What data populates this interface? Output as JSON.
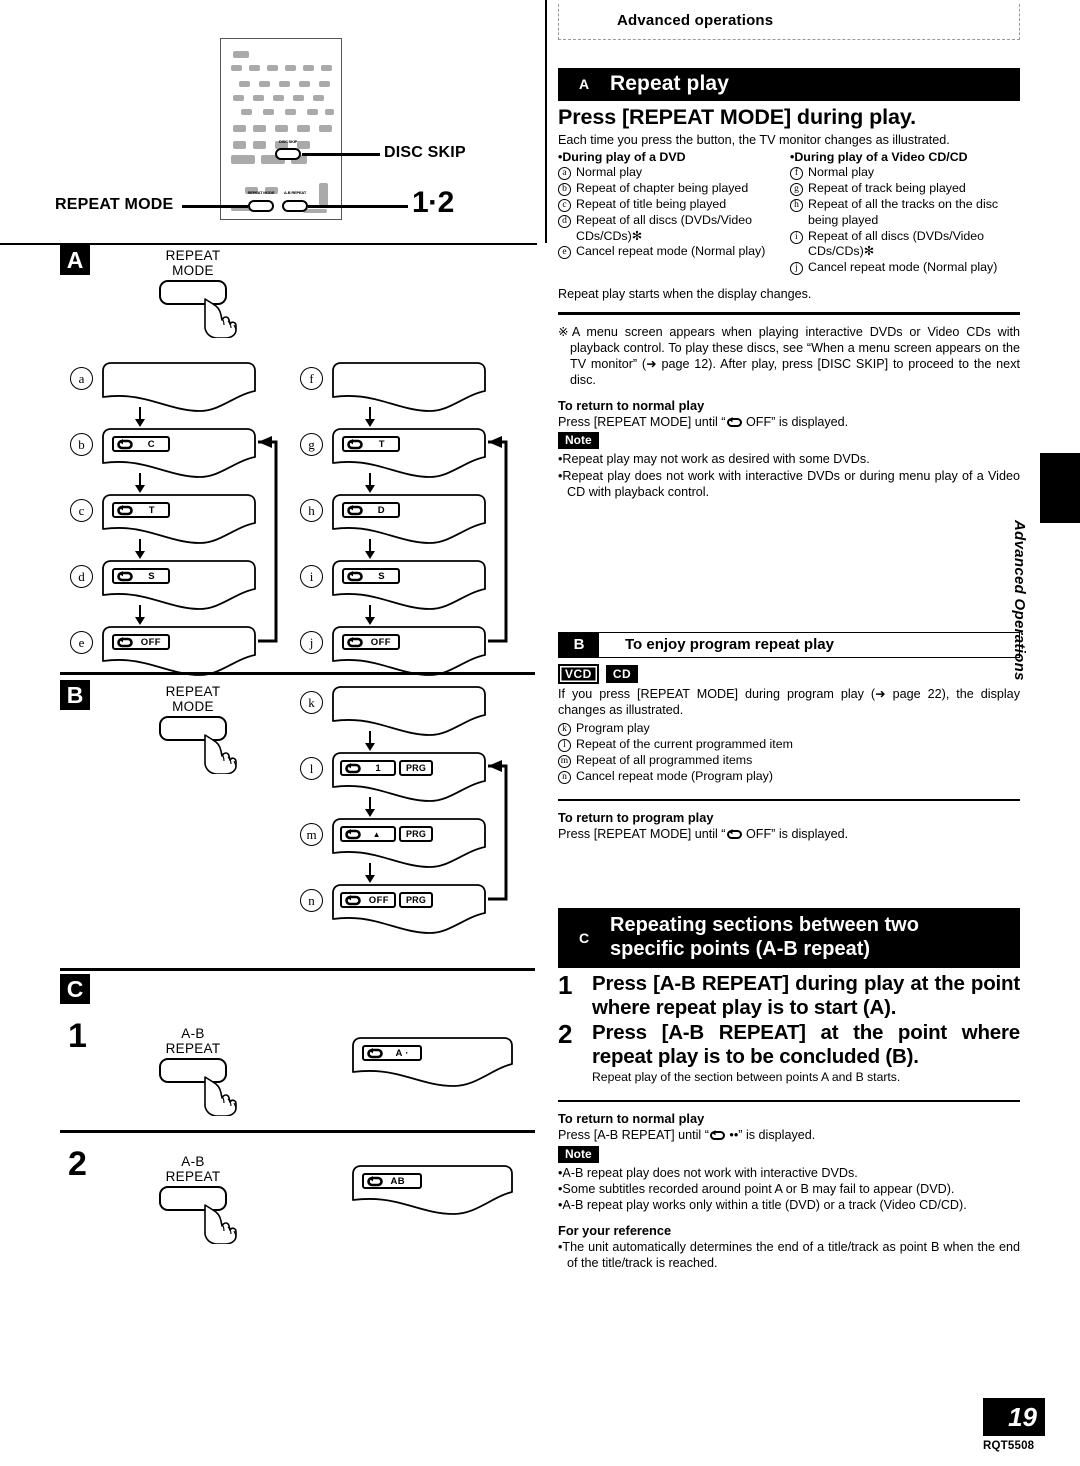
{
  "meta": {
    "breadcrumb": "Advanced operations",
    "side_tab_text": "Advanced Operations",
    "page_number": "19",
    "page_code": "RQT5508"
  },
  "remote_diagram": {
    "callout_repeat_mode": "REPEAT MODE",
    "callout_disc_skip": "DISC SKIP",
    "callout_12": "1·2",
    "key_labels": {
      "disc_skip": "DISC SKIP",
      "repeat_mode": "REPEAT MODE",
      "ab_repeat": "A-B REPEAT"
    }
  },
  "figure_a": {
    "badge": "A",
    "button_label": "REPEAT\nMODE",
    "left_sequence": [
      {
        "mark": "a",
        "indicator": "",
        "prg": false
      },
      {
        "mark": "b",
        "indicator": "C",
        "prg": false
      },
      {
        "mark": "c",
        "indicator": "T",
        "prg": false
      },
      {
        "mark": "d",
        "indicator": "S",
        "prg": false
      },
      {
        "mark": "e",
        "indicator": "OFF",
        "prg": false
      }
    ],
    "right_sequence": [
      {
        "mark": "f",
        "indicator": "",
        "prg": false
      },
      {
        "mark": "g",
        "indicator": "T",
        "prg": false
      },
      {
        "mark": "h",
        "indicator": "D",
        "prg": false
      },
      {
        "mark": "i",
        "indicator": "S",
        "prg": false
      },
      {
        "mark": "j",
        "indicator": "OFF",
        "prg": false
      }
    ]
  },
  "figure_b": {
    "badge": "B",
    "button_label": "REPEAT\nMODE",
    "sequence": [
      {
        "mark": "k",
        "indicator": "",
        "prg": false
      },
      {
        "mark": "l",
        "indicator": "1",
        "prg": true,
        "prg_label": "PRG"
      },
      {
        "mark": "m",
        "indicator": "▲",
        "prg": true,
        "prg_label": "PRG"
      },
      {
        "mark": "n",
        "indicator": "OFF",
        "prg": true,
        "prg_label": "PRG"
      }
    ]
  },
  "figure_c": {
    "badge": "C",
    "steps": [
      {
        "num": "1",
        "button_label": "A-B\nREPEAT",
        "indicator": "A ·"
      },
      {
        "num": "2",
        "button_label": "A-B\nREPEAT",
        "indicator": "AB"
      }
    ]
  },
  "section_a": {
    "letter": "A",
    "title": "Repeat play",
    "heading": "Press [REPEAT MODE] during play.",
    "intro": "Each time you press the button, the TV monitor changes as illustrated.",
    "col_left_head": "During play of a DVD",
    "col_right_head": "During play of a Video CD/CD",
    "col_left_items": [
      {
        "mark": "a",
        "text": "Normal play"
      },
      {
        "mark": "b",
        "text": "Repeat of chapter being played"
      },
      {
        "mark": "c",
        "text": "Repeat of title being played"
      },
      {
        "mark": "d",
        "text": "Repeat of all discs (DVDs/Video CDs/CDs)✻"
      },
      {
        "mark": "e",
        "text": "Cancel repeat mode (Normal play)"
      }
    ],
    "col_right_items": [
      {
        "mark": "f",
        "text": "Normal play"
      },
      {
        "mark": "g",
        "text": "Repeat of track being played"
      },
      {
        "mark": "h",
        "text": "Repeat of all the tracks on the disc being played"
      },
      {
        "mark": "i",
        "text": "Repeat of all discs (DVDs/Video CDs/CDs)✻"
      },
      {
        "mark": "j",
        "text": "Cancel repeat mode (Normal play)"
      }
    ],
    "after_note": "Repeat play starts when the display changes.",
    "asterisk_note": "※A menu screen appears when playing interactive DVDs or Video CDs with playback control. To play these discs, see “When a menu screen appears on the TV monitor” (➜ page 12). After play, press [DISC SKIP] to proceed to the next disc.",
    "return_head": "To return to normal play",
    "return_text_pre": "Press [REPEAT MODE] until “",
    "return_text_post": " OFF” is displayed.",
    "note_badge": "Note",
    "notes": [
      "Repeat play may not work as desired with some DVDs.",
      "Repeat play does not work with interactive DVDs or during menu play of a Video CD with playback control."
    ]
  },
  "section_b": {
    "letter": "B",
    "title": "To enjoy program repeat play",
    "badge_vcd": "VCD",
    "badge_cd": "CD",
    "intro": "If you press [REPEAT MODE] during program play (➜ page 22), the display changes as illustrated.",
    "items": [
      {
        "mark": "k",
        "text": "Program play"
      },
      {
        "mark": "l",
        "text": "Repeat of the current programmed item"
      },
      {
        "mark": "m",
        "text": "Repeat of all programmed items"
      },
      {
        "mark": "n",
        "text": "Cancel repeat mode (Program play)"
      }
    ],
    "return_head": "To return to program play",
    "return_text_pre": "Press [REPEAT MODE] until “",
    "return_text_post": " OFF” is displayed."
  },
  "section_c": {
    "letter": "C",
    "title_line1": "Repeating sections between two",
    "title_line2": "specific points (A-B repeat)",
    "steps": [
      {
        "num": "1",
        "text": "Press [A-B REPEAT] during play at the point where repeat play is to start (A)."
      },
      {
        "num": "2",
        "text": "Press [A-B REPEAT] at the point where repeat play is to be concluded (B)."
      }
    ],
    "after_step": "Repeat play of the section between points A and B starts.",
    "return_head": "To return to normal play",
    "return_text_pre": "Press [A-B REPEAT] until “",
    "return_text_post": " ••” is displayed.",
    "note_badge": "Note",
    "notes": [
      "A-B repeat play does not work with interactive DVDs.",
      "Some subtitles recorded around point A or B may fail to appear (DVD).",
      "A-B repeat play works only within a title (DVD) or a track (Video CD/CD)."
    ],
    "reference_head": "For your reference",
    "reference_notes": [
      "The unit automatically determines the end of a title/track as point B when the end of the title/track is reached."
    ]
  }
}
